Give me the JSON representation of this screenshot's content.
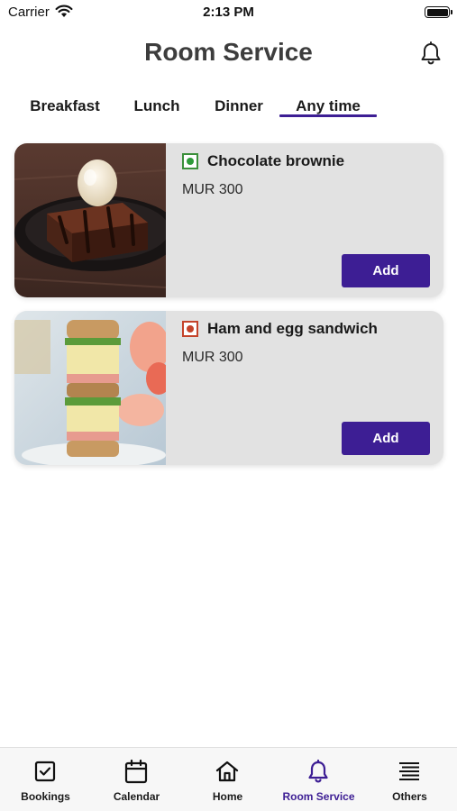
{
  "status_bar": {
    "carrier": "Carrier",
    "time": "2:13 PM"
  },
  "header": {
    "title": "Room Service",
    "icon": "bell-icon"
  },
  "tabs": [
    {
      "label": "Breakfast",
      "active": false
    },
    {
      "label": "Lunch",
      "active": false
    },
    {
      "label": "Dinner",
      "active": false
    },
    {
      "label": "Any time",
      "active": true
    }
  ],
  "menu_items": [
    {
      "name": "Chocolate brownie",
      "price": "MUR 300",
      "diet": "veg",
      "button": "Add"
    },
    {
      "name": "Ham and egg sandwich",
      "price": "MUR 300",
      "diet": "non-veg",
      "button": "Add"
    }
  ],
  "bottom_nav": [
    {
      "label": "Bookings",
      "icon": "checkbox-icon",
      "active": false
    },
    {
      "label": "Calendar",
      "icon": "calendar-icon",
      "active": false
    },
    {
      "label": "Home",
      "icon": "home-icon",
      "active": false
    },
    {
      "label": "Room Service",
      "icon": "bell-icon",
      "active": true
    },
    {
      "label": "Others",
      "icon": "menu-lines-icon",
      "active": false
    }
  ],
  "colors": {
    "accent": "#3d1e94",
    "card_bg": "#e2e2e2",
    "veg": "#2e9a3a",
    "non_veg": "#c4432a"
  }
}
